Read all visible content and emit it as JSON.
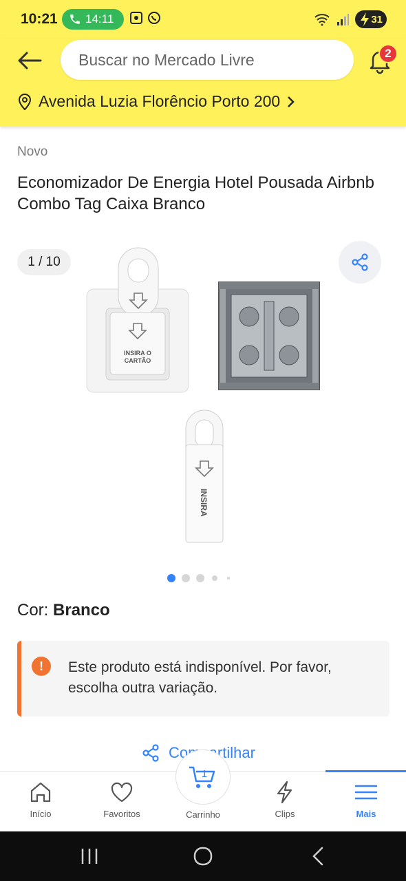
{
  "status_bar": {
    "time": "10:21",
    "call_time": "14:11",
    "battery": "31"
  },
  "header": {
    "search_placeholder": "Buscar no Mercado Livre",
    "notification_count": "2",
    "address": "Avenida Luzia Florêncio Porto 200"
  },
  "product": {
    "condition": "Novo",
    "title": "Economizador De Energia Hotel Pousada Airbnb Combo Tag Caixa Branco",
    "gallery_counter": "1 / 10",
    "image_labels": {
      "card_text_line1": "INSIRA O",
      "card_text_line2": "CARTÃO",
      "tag_text": "INSIRA"
    },
    "color_label": "Cor:",
    "color_value": "Branco",
    "alert_message": "Este produto está indisponível. Por favor, escolha outra variação.",
    "alert_icon": "!",
    "share_label": "Compartilhar"
  },
  "bottom_nav": {
    "items": [
      {
        "label": "Início",
        "icon": "home-icon"
      },
      {
        "label": "Favoritos",
        "icon": "heart-icon"
      },
      {
        "label": "Carrinho",
        "icon": "cart-icon",
        "badge": "1"
      },
      {
        "label": "Clips",
        "icon": "lightning-icon"
      },
      {
        "label": "Mais",
        "icon": "menu-icon",
        "active": true
      }
    ]
  },
  "colors": {
    "brand_yellow": "#fff159",
    "accent_blue": "#3483fa",
    "alert_orange": "#f07332"
  }
}
